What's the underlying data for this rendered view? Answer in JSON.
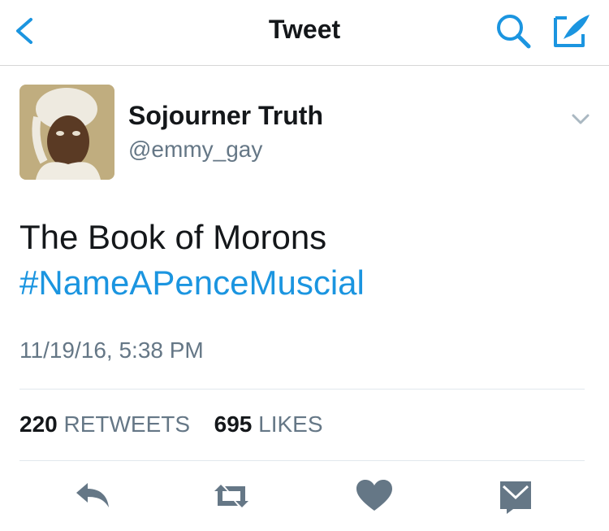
{
  "nav": {
    "title": "Tweet"
  },
  "icons": {
    "back": "chevron-left-icon",
    "search": "search-icon",
    "compose": "compose-icon",
    "more": "chevron-down-icon",
    "reply": "reply-icon",
    "retweet": "retweet-icon",
    "like": "heart-icon",
    "dm": "envelope-icon"
  },
  "colors": {
    "accent": "#1b95e0",
    "text": "#14171a",
    "secondary": "#657786",
    "icon": "#657786"
  },
  "tweet": {
    "author_name": "Sojourner Truth",
    "handle": "@emmy_gay",
    "text": "The Book of Morons",
    "hashtag": "#NameAPenceMuscial",
    "timestamp": "11/19/16, 5:38 PM",
    "retweets_count": "220",
    "retweets_label": "RETWEETS",
    "likes_count": "695",
    "likes_label": "LIKES"
  }
}
